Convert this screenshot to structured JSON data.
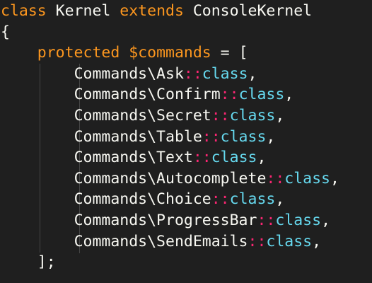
{
  "editor": {
    "theme": {
      "background": "#1f1f1f",
      "text": "#f8f8f2",
      "keyword": "#fd971f",
      "operator": "#f92672",
      "class_keyword": "#66d9ef",
      "indent_guide": "#454545"
    },
    "line1": {
      "kw_class": "class",
      "name": " Kernel ",
      "kw_extends": "extends",
      "parent": " ConsoleKernel"
    },
    "line2": {
      "brace": "{"
    },
    "line3": {
      "indent": "    ",
      "kw_protected": "protected",
      "space": " ",
      "variable": "$commands",
      "assign": " = ",
      "bracket": "["
    },
    "commands": [
      {
        "prefix": "Commands\\Ask",
        "scope": "::",
        "kw": "class",
        "trail": ","
      },
      {
        "prefix": "Commands\\Confirm",
        "scope": "::",
        "kw": "class",
        "trail": ","
      },
      {
        "prefix": "Commands\\Secret",
        "scope": "::",
        "kw": "class",
        "trail": ","
      },
      {
        "prefix": "Commands\\Table",
        "scope": "::",
        "kw": "class",
        "trail": ","
      },
      {
        "prefix": "Commands\\Text",
        "scope": "::",
        "kw": "class",
        "trail": ","
      },
      {
        "prefix": "Commands\\Autocomplete",
        "scope": "::",
        "kw": "class",
        "trail": ","
      },
      {
        "prefix": "Commands\\Choice",
        "scope": "::",
        "kw": "class",
        "trail": ","
      },
      {
        "prefix": "Commands\\ProgressBar",
        "scope": "::",
        "kw": "class",
        "trail": ","
      },
      {
        "prefix": "Commands\\SendEmails",
        "scope": "::",
        "kw": "class",
        "trail": ","
      }
    ],
    "closing": {
      "indent": "    ",
      "text": "];"
    }
  }
}
